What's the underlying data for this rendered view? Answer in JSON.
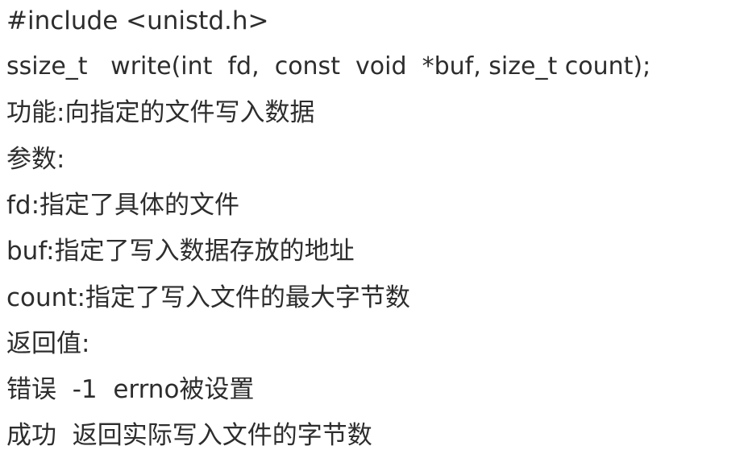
{
  "document": {
    "lines": [
      "#include <unistd.h>",
      "ssize_t   write(int  fd,  const  void  *buf, size_t count);",
      "功能:向指定的文件写入数据",
      "参数:",
      "fd:指定了具体的文件",
      "buf:指定了写入数据存放的地址",
      "count:指定了写入文件的最大字节数",
      "返回值:",
      "错误  -1  errno被设置",
      "成功  返回实际写入文件的字节数"
    ]
  },
  "colors": {
    "background": "#ffffff",
    "text": "#2d2d2d"
  }
}
